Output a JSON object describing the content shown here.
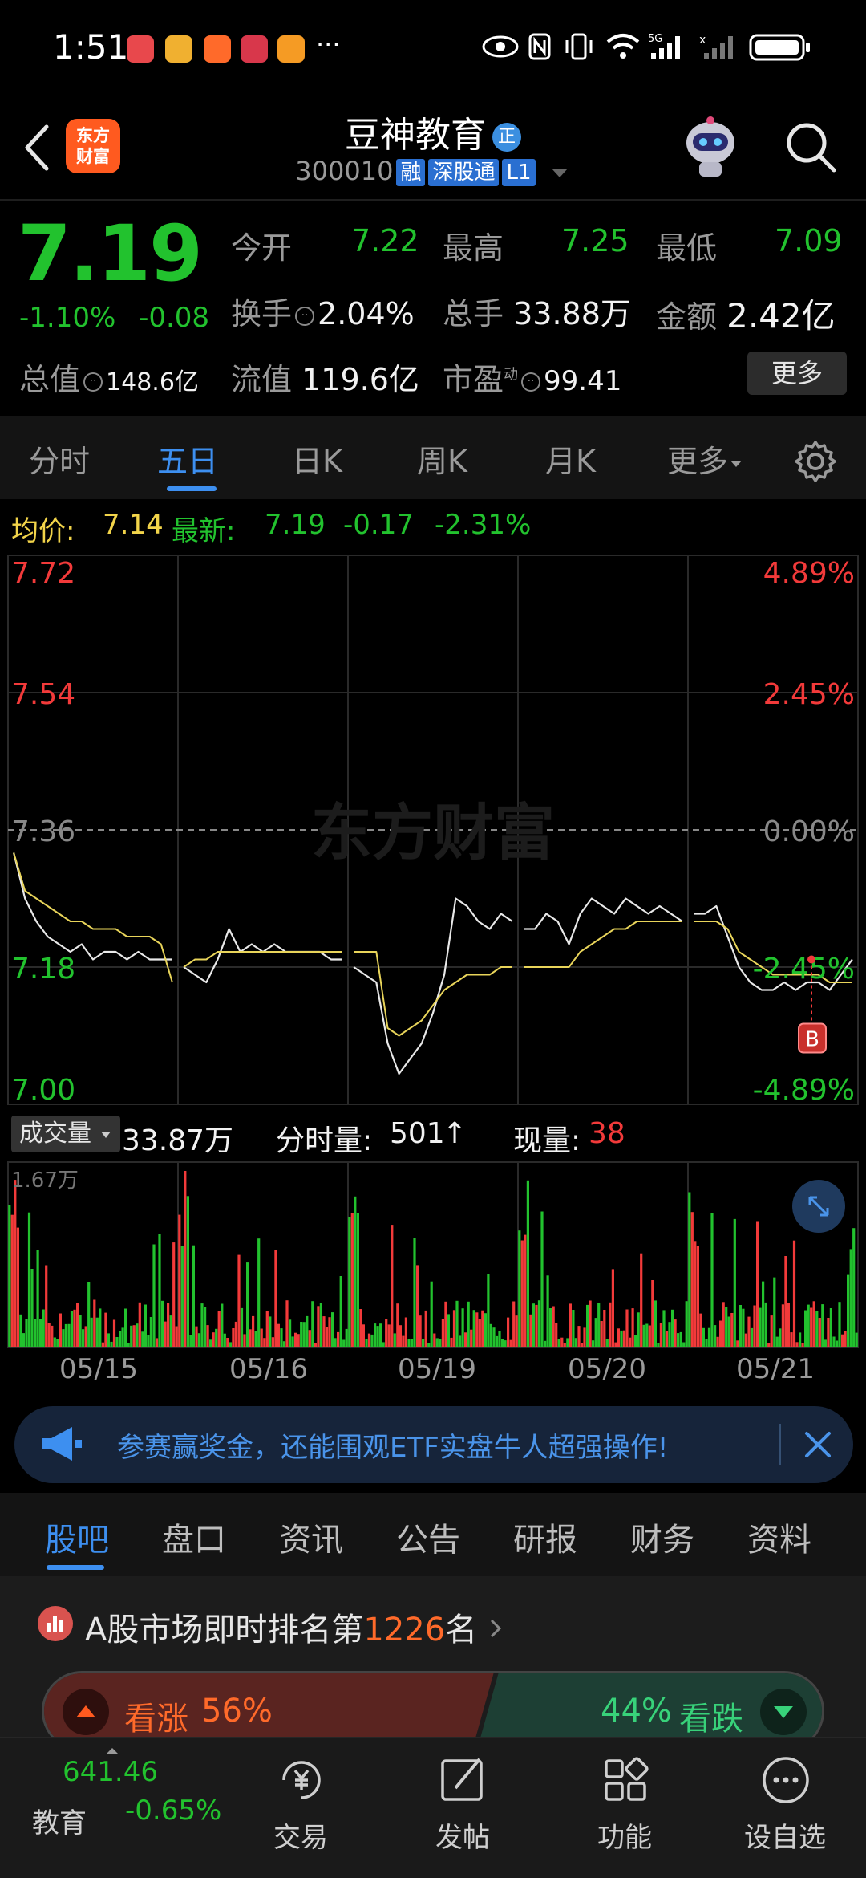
{
  "status_bar": {
    "time": "1:51",
    "more": "···"
  },
  "header": {
    "back_icon": "chevron-left-icon",
    "logo_line1": "东方",
    "logo_line2": "财富",
    "stock_name": "豆神教育",
    "badge": "正",
    "code": "300010",
    "tags": [
      "融",
      "深股通",
      "L1"
    ],
    "search_icon": "search-icon"
  },
  "quote": {
    "price": "7.19",
    "change_pct": "-1.10%",
    "change": "-0.08",
    "open_label": "今开",
    "open_value": "7.22",
    "high_label": "最高",
    "high_value": "7.25",
    "low_label": "最低",
    "low_value": "7.09",
    "turnover_label": "换手",
    "turnover_value": "2.04%",
    "volume_label": "总手",
    "volume_value": "33.88万",
    "amount_label": "金额",
    "amount_value": "2.42亿",
    "mktcap_label": "总值",
    "mktcap_value": "148.6亿",
    "float_label": "流值",
    "float_value": "119.6亿",
    "pe_label": "市盈",
    "pe_sup": "动",
    "pe_value": "99.41",
    "more_button": "更多"
  },
  "tabs": {
    "items": [
      "分时",
      "五日",
      "日K",
      "周K",
      "月K",
      "更多"
    ],
    "active": "五日"
  },
  "avg_line": {
    "avg_label": "均价:",
    "avg_value": "7.14",
    "last_label": "最新:",
    "last_value": "7.19",
    "chg": "-0.17",
    "chg_pct": "-2.31%"
  },
  "chart_data": {
    "type": "line",
    "title": "",
    "x": [
      "05/15",
      "05/16",
      "05/19",
      "05/20",
      "05/21"
    ],
    "y_ticks_left": [
      "7.72",
      "7.54",
      "7.36",
      "7.18",
      "7.00"
    ],
    "y_ticks_right": [
      "4.89%",
      "2.45%",
      "0.00%",
      "-2.45%",
      "-4.89%"
    ],
    "ylim": [
      7.0,
      7.72
    ],
    "prev_close": 7.36,
    "grid": true,
    "watermark": "东方财富",
    "marker": "B",
    "series": [
      {
        "values": [
          7.33,
          7.27,
          7.24,
          7.22,
          7.21,
          7.2,
          7.21,
          7.19,
          7.2,
          7.2,
          7.19,
          7.2,
          7.19,
          7.19,
          7.19,
          7.18,
          7.17,
          7.16,
          7.19,
          7.23,
          7.2,
          7.21,
          7.2,
          7.21,
          7.2,
          7.2,
          7.2,
          7.2,
          7.19,
          7.19,
          7.18,
          7.17,
          7.16,
          7.08,
          7.04,
          7.06,
          7.08,
          7.12,
          7.17,
          7.27,
          7.26,
          7.24,
          7.23,
          7.25,
          7.24,
          7.23,
          7.23,
          7.25,
          7.24,
          7.21,
          7.25,
          7.27,
          7.26,
          7.25,
          7.27,
          7.26,
          7.25,
          7.26,
          7.25,
          7.24,
          7.25,
          7.25,
          7.26,
          7.22,
          7.18,
          7.16,
          7.15,
          7.15,
          7.16,
          7.15,
          7.16,
          7.16,
          7.15,
          7.17,
          7.19
        ]
      },
      {
        "values": [
          7.33,
          7.28,
          7.27,
          7.26,
          7.25,
          7.24,
          7.24,
          7.23,
          7.23,
          7.23,
          7.22,
          7.22,
          7.22,
          7.21,
          7.16,
          7.18,
          7.19,
          7.19,
          7.2,
          7.2,
          7.2,
          7.2,
          7.2,
          7.2,
          7.2,
          7.2,
          7.2,
          7.2,
          7.2,
          7.2,
          7.2,
          7.2,
          7.2,
          7.1,
          7.09,
          7.1,
          7.11,
          7.13,
          7.15,
          7.16,
          7.17,
          7.17,
          7.17,
          7.18,
          7.18,
          7.18,
          7.18,
          7.18,
          7.18,
          7.18,
          7.2,
          7.21,
          7.22,
          7.23,
          7.23,
          7.24,
          7.24,
          7.24,
          7.24,
          7.24,
          7.24,
          7.24,
          7.24,
          7.23,
          7.2,
          7.19,
          7.18,
          7.17,
          7.17,
          7.17,
          7.17,
          7.17,
          7.16,
          7.16,
          7.16
        ]
      }
    ],
    "volume": {
      "max_label": "1.67万",
      "label": "成交量",
      "total": "33.87万",
      "tick_label": "分时量:",
      "tick_value": "501",
      "tick_arrow": "↑",
      "current_label": "现量:",
      "current_value": "38"
    }
  },
  "banner": {
    "icon": "megaphone-icon",
    "text": "参赛赢奖金，还能围观ETF实盘牛人超强操作!",
    "close_icon": "close-icon"
  },
  "sub_tabs": {
    "items": [
      "股吧",
      "盘口",
      "资讯",
      "公告",
      "研报",
      "财务",
      "资料"
    ],
    "active": "股吧"
  },
  "rank": {
    "prefix": "A股市场即时排名第",
    "number": "1226",
    "suffix": "名",
    "bull_label": "看涨",
    "bull_pct": "56%",
    "bear_pct": "44%",
    "bear_label": "看跌",
    "colors": {
      "bull": "#5a2420",
      "bear": "#1d3f34"
    }
  },
  "bottom_nav": {
    "index_value": "641.46",
    "index_name": "教育",
    "index_chg": "-0.65%",
    "items": [
      "交易",
      "发帖",
      "功能",
      "设自选"
    ]
  }
}
